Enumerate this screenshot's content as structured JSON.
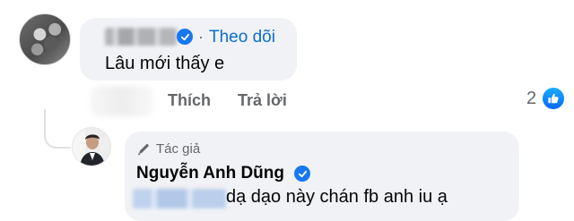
{
  "comment": {
    "follow_label": "Theo dõi",
    "separator": "·",
    "text": "Lâu mới thấy e",
    "actions": {
      "like_label": "Thích",
      "reply_label": "Trả lời",
      "reaction_count": "2"
    }
  },
  "reply": {
    "author_tag": "Tác giả",
    "author_name": "Nguyễn Anh Dũng",
    "text": "dạ dạo này chán fb anh iu ạ"
  },
  "icons": {
    "verified": "verified-check-icon",
    "like": "thumbs-up-icon",
    "author": "pen-icon"
  },
  "colors": {
    "link_blue": "#0a6dd1",
    "verified_blue": "#1877f2",
    "bubble_bg": "#f0f2f5",
    "muted_text": "#65676b"
  }
}
